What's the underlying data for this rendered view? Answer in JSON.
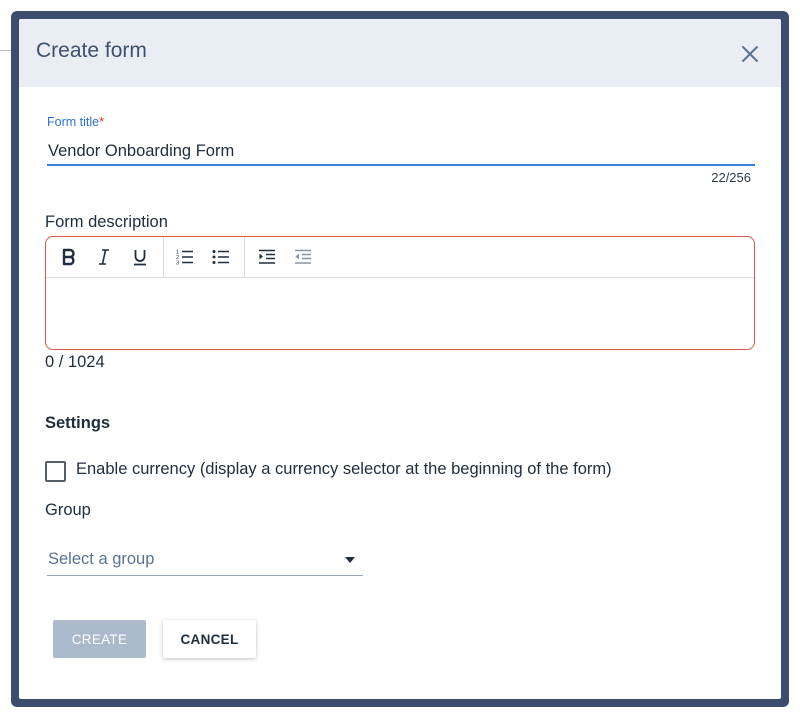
{
  "dialog": {
    "title": "Create form",
    "close_label": "×"
  },
  "form_title": {
    "label": "Form title",
    "required_mark": "*",
    "value": "Vendor Onboarding Form",
    "char_count": "22/256"
  },
  "description": {
    "label": "Form description",
    "char_count": "0 / 1024",
    "toolbar": [
      "bold-icon",
      "italic-icon",
      "underline-icon",
      "ordered-list-icon",
      "unordered-list-icon",
      "indent-icon",
      "outdent-icon"
    ]
  },
  "settings": {
    "heading": "Settings",
    "currency_label": "Enable currency (display a currency selector at the beginning of the form)",
    "currency_checked": false
  },
  "group": {
    "label": "Group",
    "placeholder": "Select a group"
  },
  "actions": {
    "create_label": "CREATE",
    "cancel_label": "CANCEL"
  },
  "colors": {
    "frame": "#3a4d6f",
    "header_bg": "#e9eef4",
    "accent": "#3a7fe0",
    "error_border": "#e0554a",
    "disabled_button": "#aab9cc"
  }
}
